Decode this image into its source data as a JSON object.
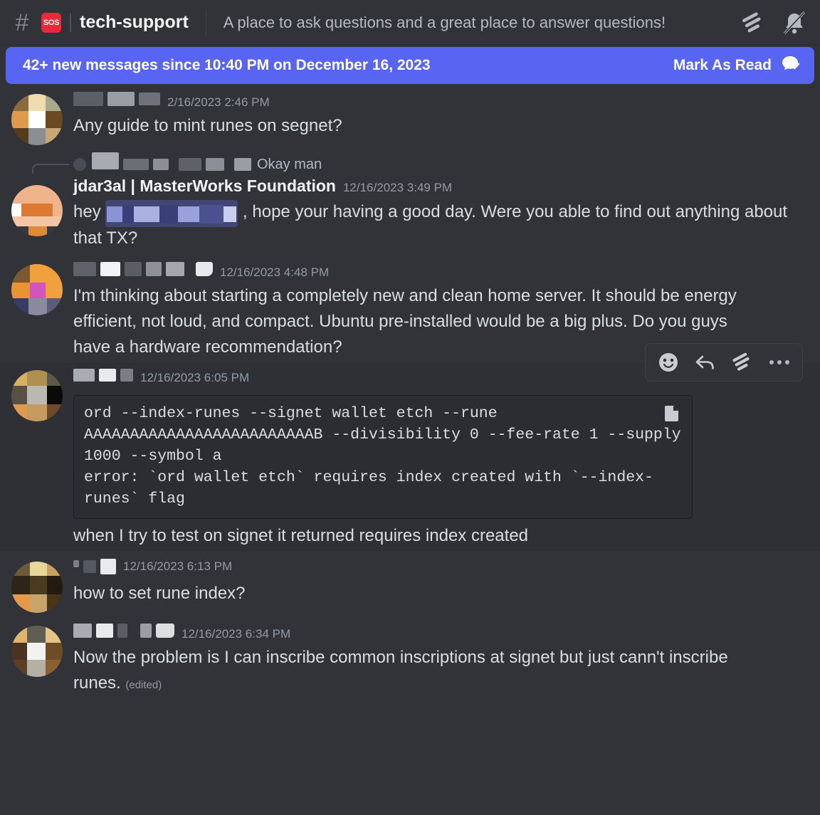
{
  "header": {
    "hash_icon": "hash-icon",
    "badge_label": "SOS",
    "channel_name": "tech-support",
    "topic": "A place to ask questions and a great place to answer questions!",
    "threads_icon": "threads-icon",
    "notifications_muted_icon": "bell-muted-icon"
  },
  "new_messages_banner": {
    "text": "42+ new messages since 10:40 PM on December 16, 2023",
    "mark_as_read_label": "Mark As Read",
    "mark_as_read_icon": "mark-read-check-icon",
    "background_color": "#5865F2"
  },
  "theme": {
    "app_background": "#313338",
    "code_background": "#2B2D31",
    "accent": "#5865F2",
    "text_primary": "#DBDEE1",
    "text_muted": "#949BA4"
  },
  "messages": [
    {
      "username_redacted": true,
      "timestamp": "2/16/2023 2:46 PM",
      "text": "Any guide to mint runes on segnet?"
    },
    {
      "reply_reference": {
        "username_redacted": true,
        "text": "Okay man"
      },
      "username": "jdar3al | MasterWorks Foundation",
      "timestamp": "12/16/2023 3:49 PM",
      "text_before_mention": "hey ",
      "mention_redacted": true,
      "text_after_mention": " , hope your having a good day. Were you able to find out anything about that TX?"
    },
    {
      "username_redacted": true,
      "timestamp": "12/16/2023 4:48 PM",
      "text": "I'm thinking about starting a completely new and clean home server. It should be energy efficient, not loud, and compact. Ubuntu pre-installed would be a big plus. Do you guys have a hardware recommendation?"
    },
    {
      "username_redacted": true,
      "timestamp": "12/16/2023 6:05 PM",
      "code": "ord --index-runes --signet wallet etch --rune AAAAAAAAAAAAAAAAAAAAAAAAAB --divisibility 0 --fee-rate 1 --supply 1000 --symbol a\nerror: `ord wallet etch` requires index created with `--index-runes` flag",
      "copy_icon": "copy-icon",
      "text": "when I try to test on signet it returned requires index created",
      "hover_toolbar": {
        "add_reaction_icon": "add-reaction-icon",
        "reply_icon": "reply-arrow-icon",
        "thread_icon": "create-thread-icon",
        "more_icon": "more-options-icon"
      }
    },
    {
      "username_redacted": true,
      "timestamp": "12/16/2023 6:13 PM",
      "text": "how to set rune index?"
    },
    {
      "username_redacted": true,
      "timestamp": "12/16/2023 6:34 PM",
      "text": "Now the problem is I can inscribe common inscriptions at signet but just cann't inscribe runes.",
      "edited_label": "(edited)"
    }
  ]
}
